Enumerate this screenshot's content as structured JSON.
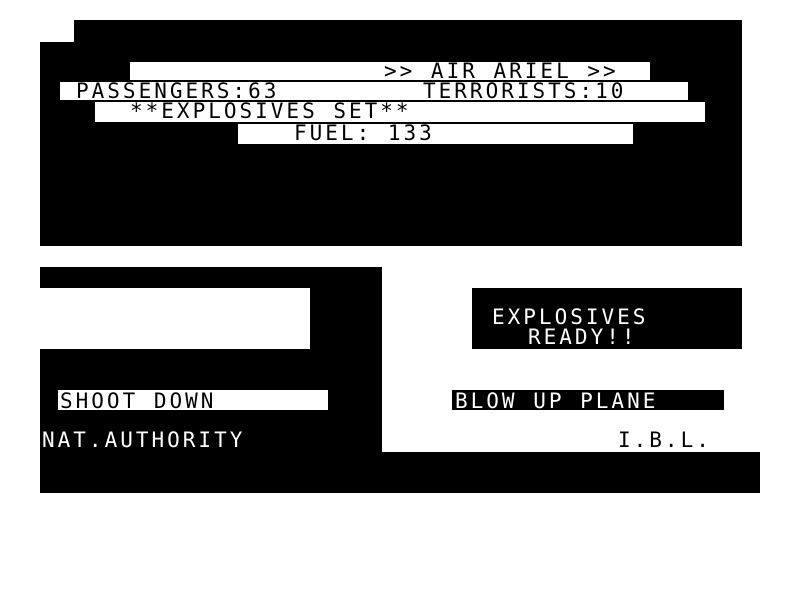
{
  "prompt": ">>",
  "header": {
    "title": ">> AIR ARIEL >>",
    "passengers": "PASSENGERS:63",
    "terrorists": "TERRORISTS:10",
    "status": "**EXPLOSIVES SET**",
    "fuel": "FUEL: 133"
  },
  "message": {
    "line1": "EXPLOSIVES",
    "line2": "READY!!"
  },
  "choices": {
    "left": {
      "action": "SHOOT DOWN",
      "owner": "NAT.AUTHORITY"
    },
    "right": {
      "action": "BLOW UP PLANE",
      "owner": "I.B.L."
    }
  },
  "colors": {
    "black": "#000000",
    "white": "#ffffff"
  }
}
